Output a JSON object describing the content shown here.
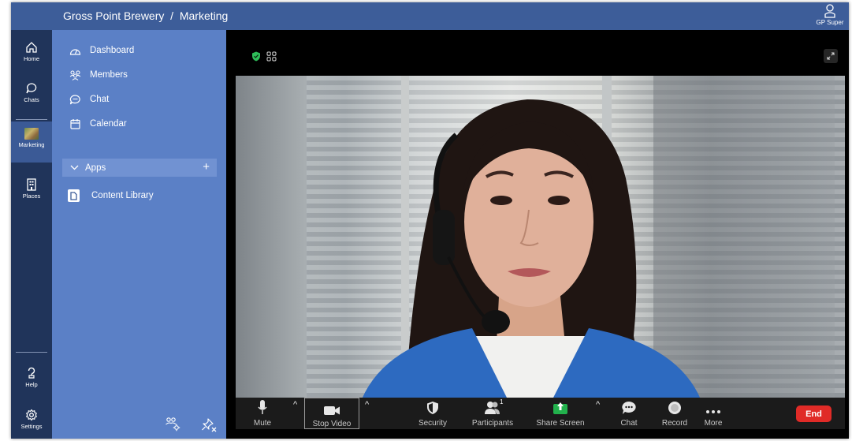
{
  "header": {
    "org": "Gross Point Brewery",
    "separator": "/",
    "section": "Marketing",
    "user_label": "GP Super"
  },
  "rail": [
    {
      "label": "Home",
      "icon": "home-icon"
    },
    {
      "label": "Chats",
      "icon": "chat-bubble-icon"
    },
    {
      "label": "Marketing",
      "icon": "team-thumbnail-icon",
      "active": true
    },
    {
      "label": "Places",
      "icon": "building-icon"
    },
    {
      "label": "Help",
      "icon": "help-icon"
    },
    {
      "label": "Settings",
      "icon": "gear-icon"
    }
  ],
  "nav": {
    "items": [
      {
        "label": "Dashboard",
        "icon": "dashboard-icon"
      },
      {
        "label": "Members",
        "icon": "members-icon"
      },
      {
        "label": "Chat",
        "icon": "chat-icon"
      },
      {
        "label": "Calendar",
        "icon": "calendar-icon"
      }
    ],
    "apps_label": "Apps",
    "apps_add": "+",
    "apps": [
      {
        "label": "Content Library",
        "icon": "document-icon"
      }
    ],
    "bottom_icons": [
      "manage-members-icon",
      "unpin-icon"
    ]
  },
  "meeting": {
    "toolbar": {
      "mute": "Mute",
      "stop_video": "Stop Video",
      "security": "Security",
      "participants": "Participants",
      "participants_count": "1",
      "share_screen": "Share Screen",
      "chat": "Chat",
      "record": "Record",
      "more": "More",
      "end": "End"
    }
  },
  "colors": {
    "topbar": "#3d5d99",
    "rail": "#20345a",
    "nav": "#5b80c6",
    "end": "#e02b27",
    "share": "#22b14c"
  }
}
